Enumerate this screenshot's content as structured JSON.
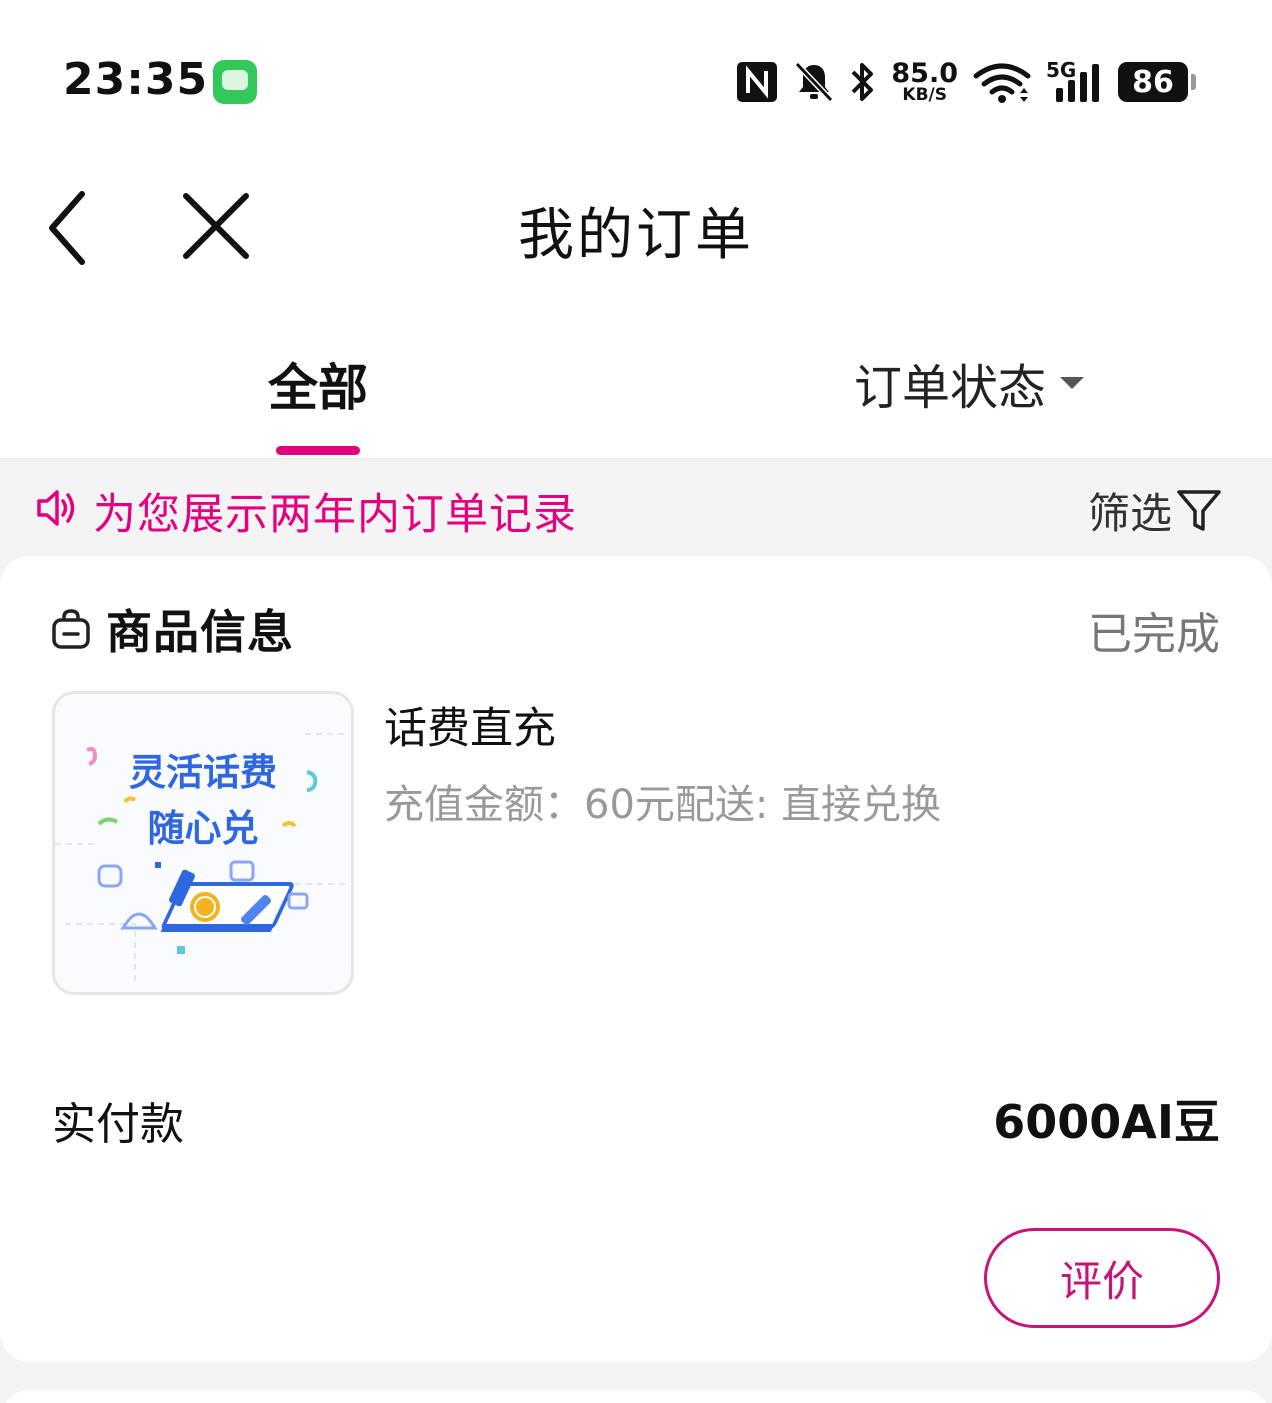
{
  "status_bar": {
    "time": "23:35",
    "net_speed_value": "85.0",
    "net_speed_unit": "KB/S",
    "network_type": "5G",
    "battery": "86"
  },
  "header": {
    "title": "我的订单"
  },
  "tabs": {
    "all_label": "全部",
    "status_label": "订单状态"
  },
  "notice": {
    "text": "为您展示两年内订单记录",
    "filter_label": "筛选"
  },
  "order": {
    "section_label": "商品信息",
    "state": "已完成",
    "thumbnail_text_line1": "灵活话费",
    "thumbnail_text_line2": "随心兑",
    "product_name": "话费直充",
    "product_desc": "充值金额：60元配送: 直接兑换",
    "paid_label": "实付款",
    "paid_value": "6000AI豆",
    "review_button": "评价"
  },
  "colors": {
    "accent": "#e4007f",
    "button_border": "#c8137a",
    "thumbnail_text": "#2e67e0"
  },
  "icons": [
    "message-app-icon",
    "nfc-icon",
    "mute-icon",
    "bluetooth-icon",
    "wifi-icon",
    "signal-icon",
    "battery-icon",
    "back-icon",
    "close-icon",
    "caret-down-icon",
    "speaker-icon",
    "filter-icon",
    "shopping-bag-icon"
  ]
}
